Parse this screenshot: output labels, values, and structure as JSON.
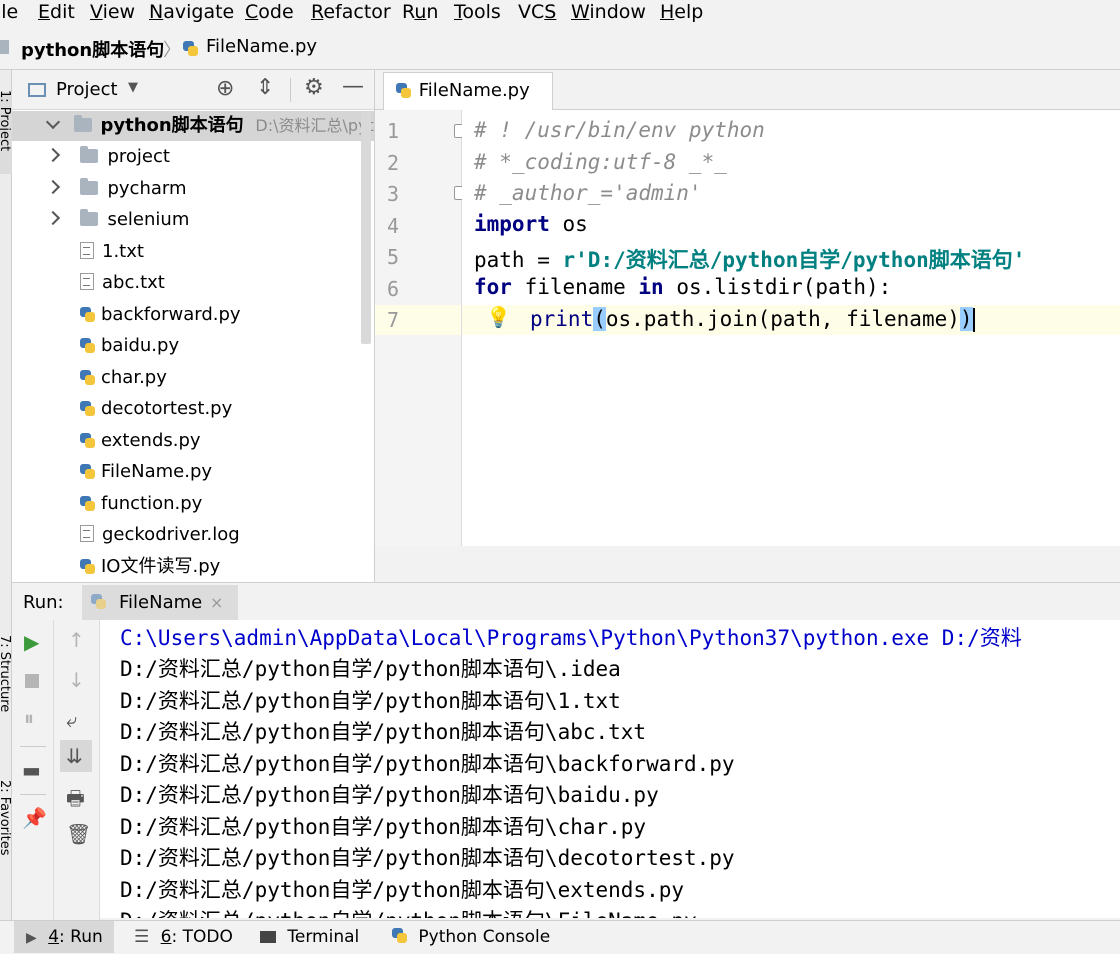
{
  "menu": [
    {
      "pre": "",
      "u": "",
      "post": "ile"
    },
    {
      "pre": "",
      "u": "E",
      "post": "dit"
    },
    {
      "pre": "",
      "u": "V",
      "post": "iew"
    },
    {
      "pre": "",
      "u": "N",
      "post": "avigate"
    },
    {
      "pre": "",
      "u": "C",
      "post": "ode"
    },
    {
      "pre": "",
      "u": "R",
      "post": "efactor"
    },
    {
      "pre": "R",
      "u": "u",
      "post": "n"
    },
    {
      "pre": "",
      "u": "T",
      "post": "ools"
    },
    {
      "pre": "VC",
      "u": "S",
      "post": ""
    },
    {
      "pre": "",
      "u": "W",
      "post": "indow"
    },
    {
      "pre": "",
      "u": "H",
      "post": "elp"
    }
  ],
  "breadcrumb": {
    "project": "python脚本语句",
    "file": "FileName.py"
  },
  "side_labels": {
    "project": "1: Project",
    "structure": "7: Structure",
    "favorites": "2: Favorites"
  },
  "project_panel": {
    "title": "Project",
    "root": {
      "name": "python脚本语句",
      "path": "D:\\资料汇总\\pytho"
    },
    "folders": [
      "project",
      "pycharm",
      "selenium"
    ],
    "files": [
      {
        "name": "1.txt",
        "type": "txt"
      },
      {
        "name": "abc.txt",
        "type": "txt"
      },
      {
        "name": "backforward.py",
        "type": "py"
      },
      {
        "name": "baidu.py",
        "type": "py"
      },
      {
        "name": "char.py",
        "type": "py"
      },
      {
        "name": "decotortest.py",
        "type": "py"
      },
      {
        "name": "extends.py",
        "type": "py"
      },
      {
        "name": "FileName.py",
        "type": "py"
      },
      {
        "name": "function.py",
        "type": "py"
      },
      {
        "name": "geckodriver.log",
        "type": "txt"
      },
      {
        "name": "IO文件读写.py",
        "type": "py"
      }
    ]
  },
  "editor": {
    "tab": "FileName.py",
    "line_numbers": [
      "1",
      "2",
      "3",
      "4",
      "5",
      "6",
      "7"
    ],
    "code": {
      "l1": "# ! /usr/bin/env python",
      "l2": "# *_coding:utf-8 _*_",
      "l3": "# _author_='admin'",
      "l4_kw": "import",
      "l4_rest": " os",
      "l5_a": "path = ",
      "l5_str": "r'D:/资料汇总/python自学/python脚本语句'",
      "l6_kw1": "for",
      "l6_mid": " filename ",
      "l6_kw2": "in",
      "l6_rest": " os.listdir(path):",
      "l7_bi": "print",
      "l7_p1": "(",
      "l7_mid": "os.path.join(path, filename)",
      "l7_p2": ")"
    }
  },
  "run": {
    "label": "Run:",
    "tab": "FileName",
    "lines": [
      "C:\\Users\\admin\\AppData\\Local\\Programs\\Python\\Python37\\python.exe D:/资料",
      "D:/资料汇总/python自学/python脚本语句\\.idea",
      "D:/资料汇总/python自学/python脚本语句\\1.txt",
      "D:/资料汇总/python自学/python脚本语句\\abc.txt",
      "D:/资料汇总/python自学/python脚本语句\\backforward.py",
      "D:/资料汇总/python自学/python脚本语句\\baidu.py",
      "D:/资料汇总/python自学/python脚本语句\\char.py",
      "D:/资料汇总/python自学/python脚本语句\\decotortest.py",
      "D:/资料汇总/python自学/python脚本语句\\extends.py",
      "D:/资料汇总/python自学/python脚本语句\\FileName.py"
    ]
  },
  "bottom_tabs": [
    {
      "num": "4",
      "label": ": Run"
    },
    {
      "num": "6",
      "label": ": TODO"
    },
    {
      "num": "",
      "label": "Terminal"
    },
    {
      "num": "",
      "label": "Python Console"
    }
  ],
  "colors": {
    "keyword": "#000080",
    "string": "#008080",
    "comment": "#8c8c8c",
    "console_first_line": "#0000cc",
    "run_green": "#3c9a3c"
  }
}
